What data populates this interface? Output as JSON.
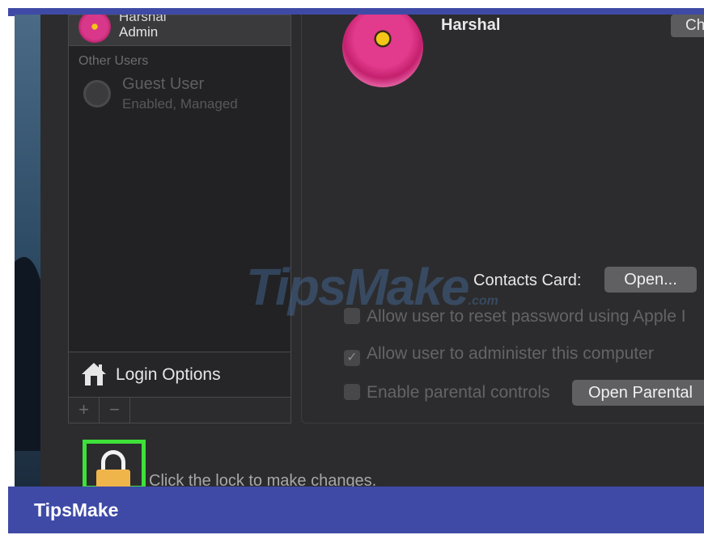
{
  "sidebar": {
    "current_user": {
      "name": "Harshal",
      "role": "Admin"
    },
    "other_users_header": "Other Users",
    "guest": {
      "name": "Guest User",
      "status": "Enabled, Managed"
    },
    "login_options_label": "Login Options",
    "add_label": "+",
    "remove_label": "−"
  },
  "main": {
    "user_name": "Harshal",
    "change_label": "Ch",
    "contacts_card_label": "Contacts Card:",
    "open_label": "Open...",
    "options": [
      {
        "label": "Allow user to reset password using Apple I",
        "checked": false
      },
      {
        "label": "Allow user to administer this computer",
        "checked": true
      },
      {
        "label": "Enable parental controls",
        "checked": false
      }
    ],
    "open_parental_label": "Open Parental"
  },
  "lock": {
    "text": "Click the lock to make changes."
  },
  "watermark": {
    "text": "TipsMake",
    "sub": ".com"
  },
  "brand": {
    "text": "TipsMake"
  },
  "colors": {
    "accent_bar": "#3f4aa6",
    "highlight": "#3ee03a",
    "lock": "#f0b54a"
  }
}
